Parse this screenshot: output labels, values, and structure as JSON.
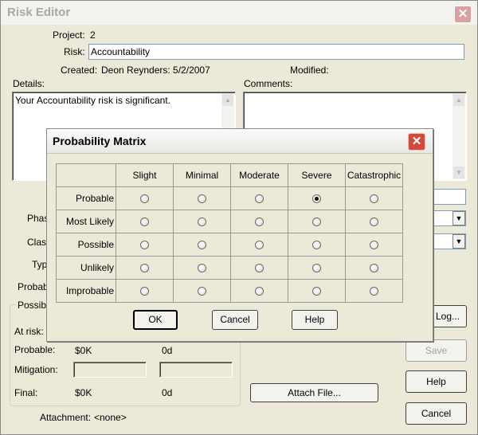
{
  "window": {
    "title": "Risk Editor"
  },
  "form": {
    "project_label": "Project:",
    "project_value": "2",
    "risk_label": "Risk:",
    "risk_value": "Accountability",
    "created_label": "Created:",
    "created_value": "Deon Reynders: 5/2/2007",
    "modified_label": "Modified:",
    "details_label": "Details:",
    "details_value": "Your Accountability risk is significant.",
    "comments_label": "Comments:",
    "phase_partial": "Phas",
    "class_partial": "Clas",
    "type_partial": "Typ",
    "probab_partial": "Probab",
    "possible_partial": "Possibl",
    "at_risk_label": "At risk:",
    "probable_label": "Probable:",
    "probable_cost": "$0K",
    "probable_time": "0d",
    "mitigation_label": "Mitigation:",
    "final_label": "Final:",
    "final_cost": "$0K",
    "final_time": "0d",
    "attachment_label": "Attachment:",
    "attachment_value": "<none>"
  },
  "buttons": {
    "log_partial": "y Log...",
    "save": "Save",
    "help": "Help",
    "cancel": "Cancel",
    "attach": "Attach File..."
  },
  "dialog": {
    "title": "Probability Matrix",
    "columns": [
      "Slight",
      "Minimal",
      "Moderate",
      "Severe",
      "Catastrophic"
    ],
    "rows": [
      "Probable",
      "Most Likely",
      "Possible",
      "Unlikely",
      "Improbable"
    ],
    "selected": {
      "row": "Probable",
      "column": "Severe"
    },
    "ok": "OK",
    "cancel": "Cancel",
    "help": "Help"
  },
  "colors": {
    "window_bg": "#ece9d8",
    "close_red": "#d24a3c"
  }
}
